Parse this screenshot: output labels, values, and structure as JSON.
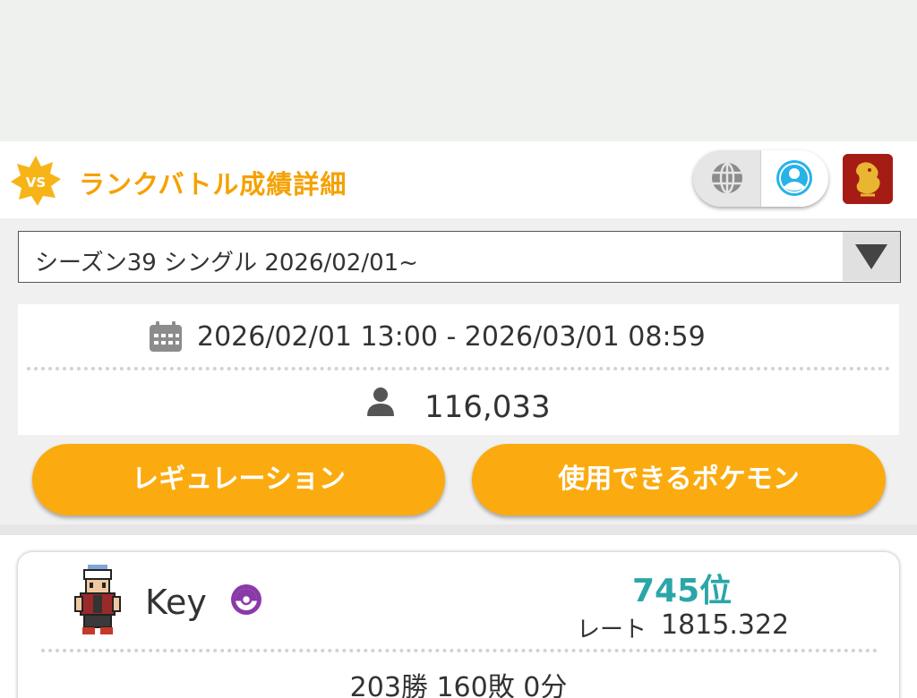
{
  "header": {
    "badge_text": "VS",
    "title": "ランクバトル成績詳細",
    "accent_color": "#f5a100",
    "icons": [
      "vs-badge-icon",
      "globe-icon",
      "user-profile-icon",
      "app-icon"
    ]
  },
  "season_select": {
    "selected": "シーズン39 シングル 2026/02/01~"
  },
  "season_info": {
    "date_range": "2026/02/01 13:00 - 2026/03/01 08:59",
    "players": "116,033"
  },
  "buttons": {
    "regulation": "レギュレーション",
    "usable_pokemon": "使用できるポケモン",
    "color": "#fbab0f"
  },
  "player": {
    "name": "Key",
    "rank": "745位",
    "rank_color": "#2aa6a8",
    "rate_label": "レート",
    "rate_value": "1815.322",
    "record": "203勝 160敗 0分"
  }
}
